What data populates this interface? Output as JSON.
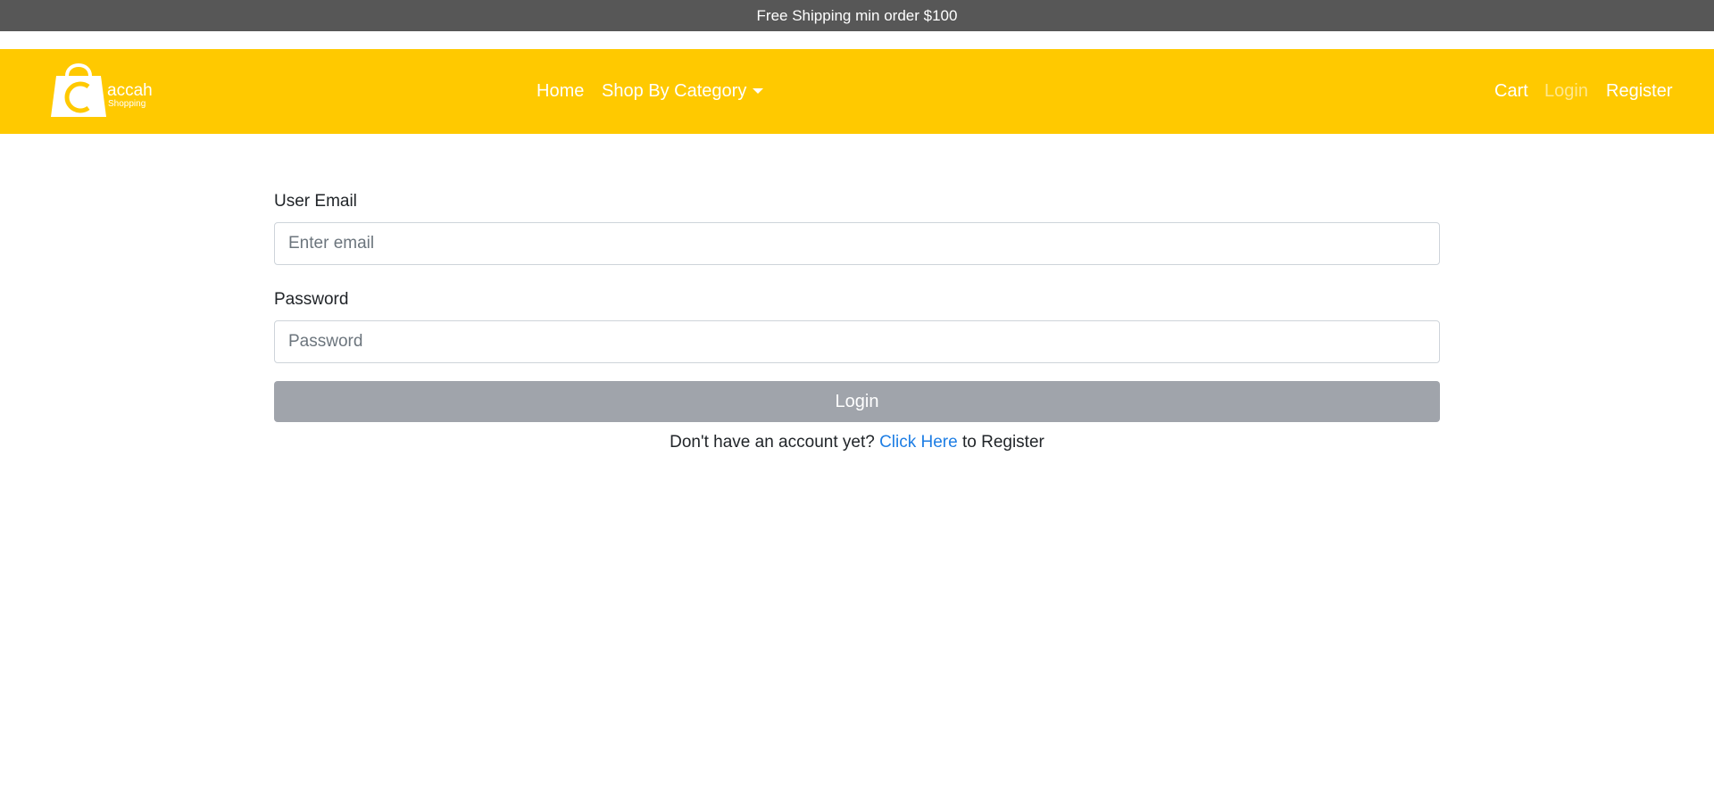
{
  "promo": {
    "text": "Free Shipping min order $100"
  },
  "navbar": {
    "brand": {
      "name": "accah",
      "tagline": "Shopping",
      "icon": "shopping-bag-icon"
    },
    "links": {
      "home": "Home",
      "category": "Shop By Category",
      "cart": "Cart",
      "login": "Login",
      "register": "Register"
    },
    "colors": {
      "background": "#ffc900",
      "promo_background": "#575757"
    }
  },
  "form": {
    "email": {
      "label": "User Email",
      "placeholder": "Enter email",
      "value": ""
    },
    "password": {
      "label": "Password",
      "placeholder": "Password",
      "value": ""
    },
    "submit_label": "Login",
    "register_prompt": {
      "before": "Don't have an account yet?",
      "link": "Click Here",
      "after": "to Register"
    },
    "colors": {
      "button": "#a0a4ab",
      "link": "#1e7ee4"
    }
  }
}
